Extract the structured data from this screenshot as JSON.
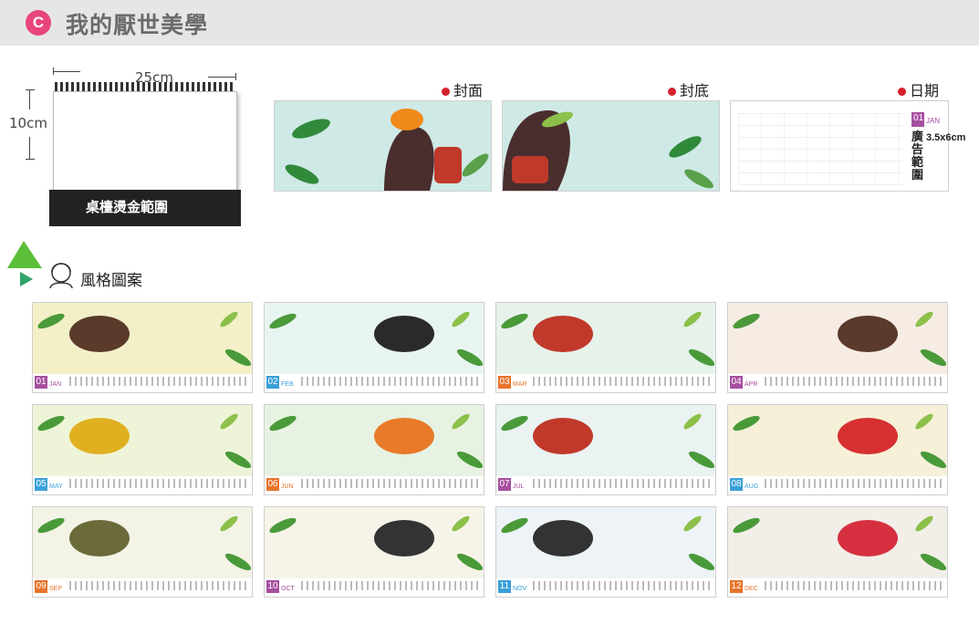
{
  "header": {
    "badge": "C",
    "title": "我的厭世美學"
  },
  "desk_calendar": {
    "width_label": "25cm",
    "height_label": "10cm",
    "foil_label": "桌檯燙金範圍"
  },
  "previews": {
    "cover_label": "封面",
    "back_label": "封底",
    "date_label": "日期",
    "date_badge": "01",
    "date_month": "JAN",
    "ad_label": "廣告範圍",
    "ad_size": "3.5x6cm"
  },
  "style_section": {
    "title": "風格圖案"
  },
  "months": [
    {
      "num": "01",
      "name": "JAN",
      "color": "#a64fa0",
      "bg": "#f3f0c8",
      "bubble": "#5a3a2a"
    },
    {
      "num": "02",
      "name": "FEB",
      "color": "#3aa0d8",
      "bg": "#e8f4f0",
      "bubble": "#2a2a2a"
    },
    {
      "num": "03",
      "name": "MAR",
      "color": "#e8742a",
      "bg": "#e6f2ea",
      "bubble": "#c0392b"
    },
    {
      "num": "04",
      "name": "APR",
      "color": "#a64fa0",
      "bg": "#f6ece4",
      "bubble": "#5a3a2a"
    },
    {
      "num": "05",
      "name": "MAY",
      "color": "#3aa0d8",
      "bg": "#eef4d8",
      "bubble": "#e0b020"
    },
    {
      "num": "06",
      "name": "JUN",
      "color": "#e8742a",
      "bg": "#e8f2e2",
      "bubble": "#e87a2a"
    },
    {
      "num": "07",
      "name": "JUL",
      "color": "#a64fa0",
      "bg": "#eaf2f2",
      "bubble": "#c0392b"
    },
    {
      "num": "08",
      "name": "AUG",
      "color": "#3aa0d8",
      "bg": "#f6f0d8",
      "bubble": "#d63030"
    },
    {
      "num": "09",
      "name": "SEP",
      "color": "#e8742a",
      "bg": "#f3f3e6",
      "bubble": "#6a6a3a"
    },
    {
      "num": "10",
      "name": "OCT",
      "color": "#a64fa0",
      "bg": "#f6f4e8",
      "bubble": "#333333"
    },
    {
      "num": "11",
      "name": "NOV",
      "color": "#3aa0d8",
      "bg": "#edf3f6",
      "bubble": "#333333"
    },
    {
      "num": "12",
      "name": "DEC",
      "color": "#e8742a",
      "bg": "#f2eee8",
      "bubble": "#d63040"
    }
  ]
}
